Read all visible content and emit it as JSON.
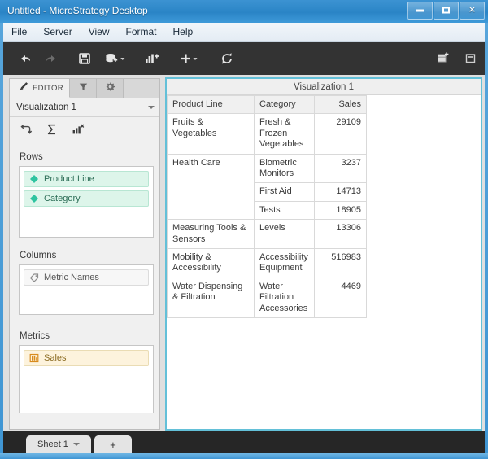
{
  "window": {
    "title": "Untitled - MicroStrategy Desktop",
    "controls": [
      {
        "name": "minimize",
        "label": "–"
      },
      {
        "name": "maximize",
        "label": "□"
      },
      {
        "name": "close",
        "label": "✕"
      }
    ]
  },
  "menu": {
    "items": [
      {
        "label": "File"
      },
      {
        "label": "Server"
      },
      {
        "label": "View"
      },
      {
        "label": "Format"
      },
      {
        "label": "Help"
      }
    ]
  },
  "toolbar": {
    "left_buttons": [
      {
        "icon": "undo-icon",
        "label": "Undo",
        "enabled": true
      },
      {
        "icon": "redo-icon",
        "label": "Redo",
        "enabled": false
      },
      {
        "icon": "save-icon",
        "label": "Save",
        "enabled": true
      },
      {
        "icon": "add-data-icon",
        "label": "Add Data",
        "enabled": true
      },
      {
        "icon": "add-visualization-icon",
        "label": "Add Visualization",
        "enabled": true
      },
      {
        "icon": "insert-icon",
        "label": "Insert",
        "enabled": true
      },
      {
        "icon": "refresh-icon",
        "label": "Refresh",
        "enabled": true
      }
    ],
    "right_buttons": [
      {
        "icon": "new-panel-icon",
        "label": "New Panel"
      },
      {
        "icon": "presentation-icon",
        "label": "Presentation Mode"
      }
    ]
  },
  "editor": {
    "tabs": [
      {
        "label": "EDITOR",
        "icon": "pencil-icon",
        "active": true
      },
      {
        "label": "",
        "icon": "filter-icon",
        "active": false
      },
      {
        "label": "",
        "icon": "gear-icon",
        "active": false
      }
    ],
    "visualization_select": "Visualization 1",
    "mini_tools": [
      {
        "icon": "swap-rows-columns-icon",
        "label": "Swap Rows and Columns"
      },
      {
        "icon": "totals-sigma-icon",
        "label": "Totals"
      },
      {
        "icon": "remove-chart-icon",
        "label": "Remove All"
      }
    ],
    "sections": [
      {
        "title": "Rows",
        "items": [
          {
            "label": "Product Line",
            "kind": "attribute",
            "icon": "attribute-diamond-icon"
          },
          {
            "label": "Category",
            "kind": "attribute",
            "icon": "attribute-diamond-icon"
          }
        ]
      },
      {
        "title": "Columns",
        "items": [
          {
            "label": "Metric Names",
            "kind": "neutral",
            "icon": "metric-names-tag-icon"
          }
        ]
      },
      {
        "title": "Metrics",
        "items": [
          {
            "label": "Sales",
            "kind": "metric",
            "icon": "metric-bars-icon"
          }
        ]
      }
    ]
  },
  "visualization": {
    "header": "Visualization 1",
    "grid": {
      "columns": [
        "Product Line",
        "Category",
        "Sales"
      ],
      "rows": [
        {
          "product_line": "Fruits & Vegetables",
          "product_line_rowspan": 1,
          "category": "Fresh & Frozen Vegetables",
          "sales": "29109"
        },
        {
          "product_line": "Health Care",
          "product_line_rowspan": 3,
          "category": "Biometric Monitors",
          "sales": "3237"
        },
        {
          "product_line": "",
          "product_line_rowspan": 0,
          "category": "First Aid",
          "sales": "14713"
        },
        {
          "product_line": "",
          "product_line_rowspan": 0,
          "category": "Tests",
          "sales": "18905"
        },
        {
          "product_line": "Measuring Tools & Sensors",
          "product_line_rowspan": 1,
          "category": "Levels",
          "sales": "13306"
        },
        {
          "product_line": "Mobility & Accessibility",
          "product_line_rowspan": 1,
          "category": "Accessibility Equipment",
          "sales": "516983"
        },
        {
          "product_line": "Water Dispensing & Filtration",
          "product_line_rowspan": 1,
          "category": "Water Filtration Accessories",
          "sales": "4469"
        }
      ]
    }
  },
  "sheets": {
    "tabs": [
      {
        "label": "Sheet 1",
        "active": true
      }
    ],
    "add_label": "+"
  },
  "colors": {
    "titlebar_blue": "#2f86c6",
    "toolbar_dark": "#333333",
    "viz_border": "#63c0d8",
    "attribute_chip": "#ddf5ea",
    "metric_chip": "#fdf3dd",
    "sheetbar_dark": "#262626"
  }
}
